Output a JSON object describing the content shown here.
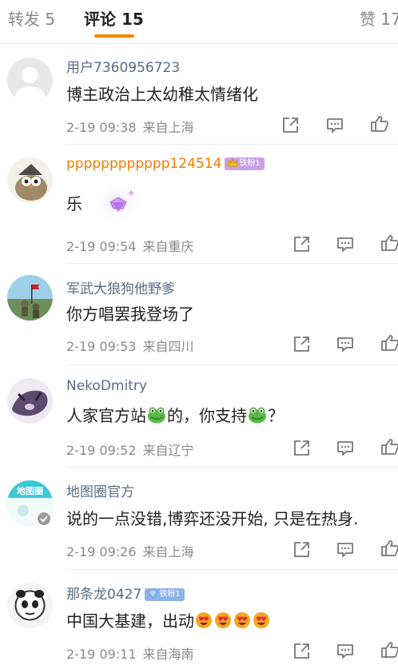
{
  "tabs": [
    {
      "label": "转发 5"
    },
    {
      "label": "评论 15"
    },
    {
      "label": "赞 17"
    }
  ],
  "comments": [
    {
      "user": "用户7360956723",
      "text": "博主政治上太幼稚太情绪化",
      "time": "2-19 09:38",
      "location": "来自上海"
    },
    {
      "user": "pppppppppppp124514",
      "badge": "铁粉1",
      "text": "乐",
      "time": "2-19 09:54",
      "location": "来自重庆"
    },
    {
      "user": "军武大狼狗他野爹",
      "text": "你方唱罢我登场了",
      "time": "2-19 09:53",
      "location": "来自四川"
    },
    {
      "user": "NekoDmitry",
      "text_parts": [
        "人家官方站",
        "的，你支持",
        "？"
      ],
      "time": "2-19 09:52",
      "location": "来自辽宁"
    },
    {
      "user": "地图圈官方",
      "text": "说的一点没错,博弈还没开始, 只是在热身.",
      "time": "2-19 09:26",
      "location": "来自上海"
    },
    {
      "user": "那条龙0427",
      "badge": "铁粉1",
      "text": "中国大基建，出动",
      "time": "2-19 09:11",
      "location": "来自海南"
    }
  ],
  "colors": {
    "accent": "#ff8200",
    "username": "#5a6b82",
    "vip_username": "#f07c00",
    "meta": "#8a8a8a"
  },
  "icons": [
    "share-icon",
    "comment-icon",
    "like-icon",
    "gem-sticker-icon",
    "frog-emoji-icon",
    "heart-eyes-emoji-icon",
    "verified-icon"
  ]
}
